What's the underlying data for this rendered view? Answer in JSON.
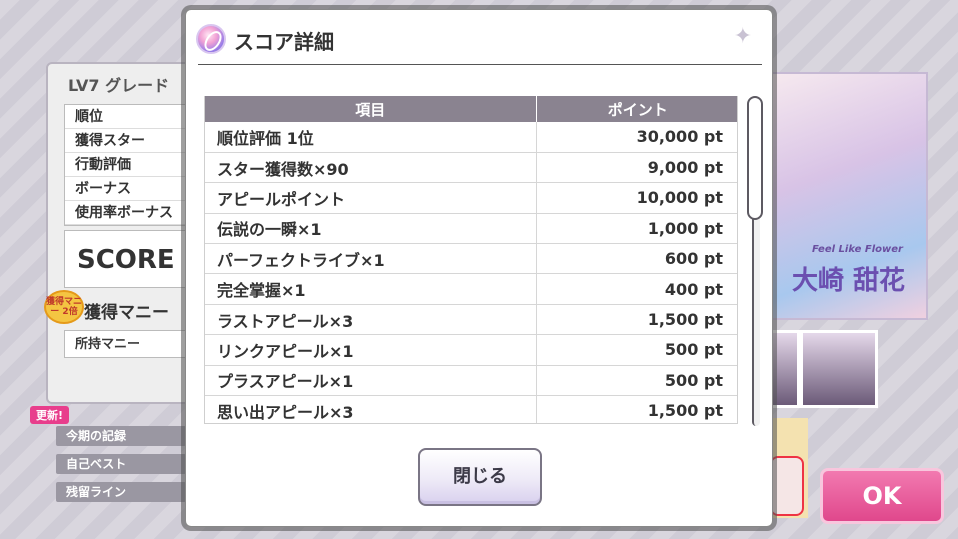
{
  "background": {
    "grade_title": "LV7 グレード",
    "rows": [
      "順位",
      "獲得スター",
      "行動評価",
      "ボーナス",
      "使用率ボーナス"
    ],
    "score_label": "SCORE",
    "money_badge": "獲得マニー 2倍",
    "money_label": "獲得マニー",
    "owned_money_label": "所持マニー",
    "new_tag": "更新!",
    "side_buttons": [
      "今期の記録",
      "自己ベスト",
      "残留ライン"
    ],
    "card_subtitle": "Feel Like Flower",
    "card_name": "大崎 甜花",
    "ok_label": "OK"
  },
  "modal": {
    "title": "スコア詳細",
    "icon": "score-medal-icon",
    "sparkle": "sparkle-icon",
    "table": {
      "headers": [
        "項目",
        "ポイント"
      ],
      "rows": [
        {
          "item": "順位評価 1位",
          "points": "30,000 pt"
        },
        {
          "item": "スター獲得数×90",
          "points": "9,000 pt"
        },
        {
          "item": "アピールポイント",
          "points": "10,000 pt"
        },
        {
          "item": "伝説の一瞬×1",
          "points": "1,000 pt"
        },
        {
          "item": "パーフェクトライブ×1",
          "points": "600 pt"
        },
        {
          "item": "完全掌握×1",
          "points": "400 pt"
        },
        {
          "item": "ラストアピール×3",
          "points": "1,500 pt"
        },
        {
          "item": "リンクアピール×1",
          "points": "500 pt"
        },
        {
          "item": "プラスアピール×1",
          "points": "500 pt"
        },
        {
          "item": "思い出アピール×3",
          "points": "1,500 pt"
        }
      ]
    },
    "close_label": "閉じる"
  },
  "colors": {
    "header_bg": "#8a8390",
    "ok_pink": "#e0488c",
    "new_tag": "#e83e8c"
  }
}
